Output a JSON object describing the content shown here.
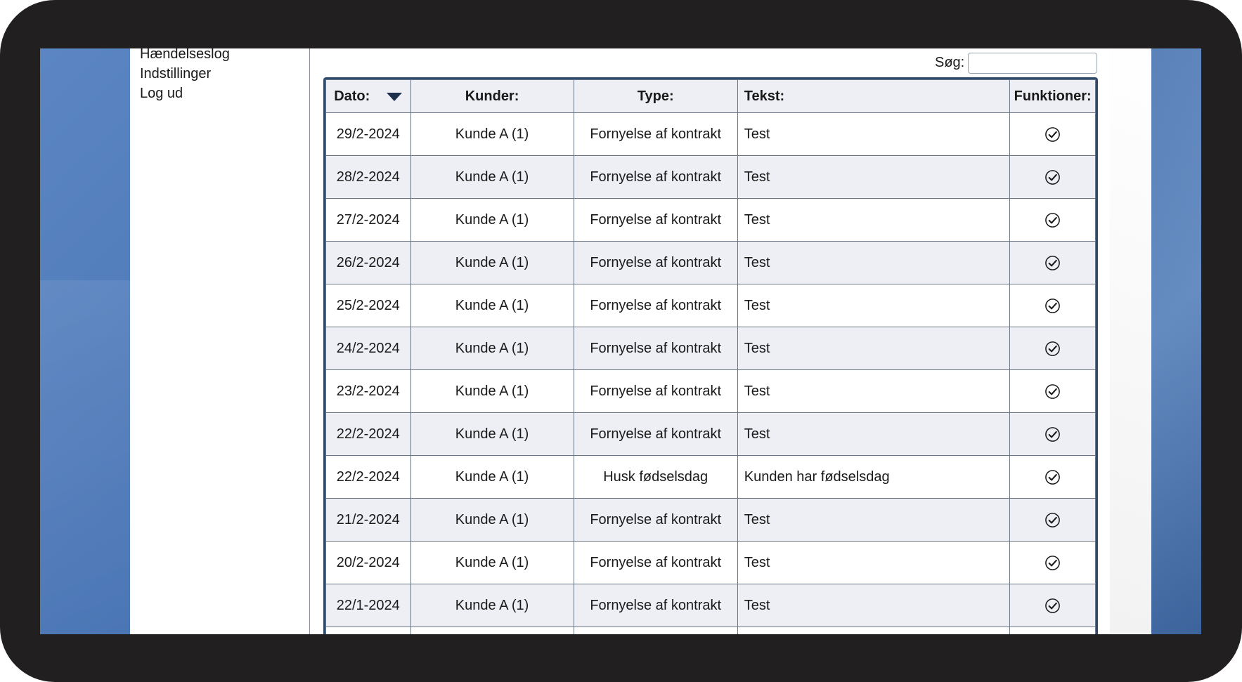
{
  "sidebar": {
    "items": [
      {
        "label": "Hændelseslog"
      },
      {
        "label": "Indstillinger"
      },
      {
        "label": "Log ud"
      }
    ]
  },
  "search": {
    "label": "Søg:",
    "value": ""
  },
  "table": {
    "columns": [
      "Dato:",
      "Kunder:",
      "Type:",
      "Tekst:",
      "Funktioner:"
    ],
    "sort": {
      "column": "Dato:",
      "direction": "descending"
    },
    "rows": [
      {
        "date": "29/2-2024",
        "customer": "Kunde A (1)",
        "type": "Fornyelse af kontrakt",
        "text": "Test",
        "action_icon": "check-circle-icon"
      },
      {
        "date": "28/2-2024",
        "customer": "Kunde A (1)",
        "type": "Fornyelse af kontrakt",
        "text": "Test",
        "action_icon": "check-circle-icon"
      },
      {
        "date": "27/2-2024",
        "customer": "Kunde A (1)",
        "type": "Fornyelse af kontrakt",
        "text": "Test",
        "action_icon": "check-circle-icon"
      },
      {
        "date": "26/2-2024",
        "customer": "Kunde A (1)",
        "type": "Fornyelse af kontrakt",
        "text": "Test",
        "action_icon": "check-circle-icon"
      },
      {
        "date": "25/2-2024",
        "customer": "Kunde A (1)",
        "type": "Fornyelse af kontrakt",
        "text": "Test",
        "action_icon": "check-circle-icon"
      },
      {
        "date": "24/2-2024",
        "customer": "Kunde A (1)",
        "type": "Fornyelse af kontrakt",
        "text": "Test",
        "action_icon": "check-circle-icon"
      },
      {
        "date": "23/2-2024",
        "customer": "Kunde A (1)",
        "type": "Fornyelse af kontrakt",
        "text": "Test",
        "action_icon": "check-circle-icon"
      },
      {
        "date": "22/2-2024",
        "customer": "Kunde A (1)",
        "type": "Fornyelse af kontrakt",
        "text": "Test",
        "action_icon": "check-circle-icon"
      },
      {
        "date": "22/2-2024",
        "customer": "Kunde A (1)",
        "type": "Husk fødselsdag",
        "text": "Kunden har fødselsdag",
        "action_icon": "check-circle-icon"
      },
      {
        "date": "21/2-2024",
        "customer": "Kunde A (1)",
        "type": "Fornyelse af kontrakt",
        "text": "Test",
        "action_icon": "check-circle-icon"
      },
      {
        "date": "20/2-2024",
        "customer": "Kunde A (1)",
        "type": "Fornyelse af kontrakt",
        "text": "Test",
        "action_icon": "check-circle-icon"
      },
      {
        "date": "22/1-2024",
        "customer": "Kunde A (1)",
        "type": "Fornyelse af kontrakt",
        "text": "Test",
        "action_icon": "check-circle-icon"
      },
      {
        "date": "",
        "customer": "",
        "type": "",
        "text": "",
        "action_icon": ""
      }
    ]
  }
}
